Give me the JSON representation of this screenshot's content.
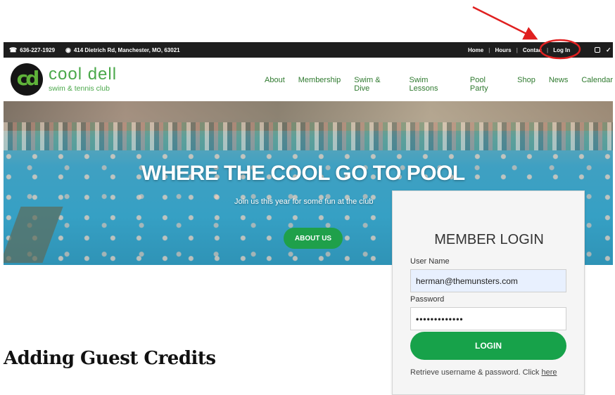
{
  "topbar": {
    "phone": "636-227-1929",
    "address": "414 Dietrich Rd, Manchester, MO, 63021",
    "nav": [
      "Home",
      "Hours",
      "Contac",
      "Log In"
    ]
  },
  "logo": {
    "mark": "cd",
    "title": "cool dell",
    "subtitle": "swim & tennis club"
  },
  "mainnav": [
    "About",
    "Membership",
    "Swim & Dive",
    "Swim Lessons",
    "Pool Party",
    "Shop",
    "News",
    "Calendar"
  ],
  "hero": {
    "title": "WHERE THE COOL GO TO POOL",
    "subtitle": "Join us this year for some fun at the club",
    "button": "ABOUT US"
  },
  "section_heading": "Adding Guest Credits",
  "login": {
    "title": "MEMBER LOGIN",
    "username_label": "User Name",
    "username_value": "herman@themunsters.com",
    "password_label": "Password",
    "password_value": "•••••••••••••",
    "button": "LOGIN",
    "retrieve_text": "Retrieve username & password. Click ",
    "retrieve_link": "here"
  },
  "colors": {
    "brand_green": "#4aa84a",
    "button_green": "#17a24a",
    "annotation_red": "#e02020",
    "topbar_bg": "#1e1e1e"
  },
  "icons": [
    "phone-icon",
    "map-pin-icon",
    "instagram-icon",
    "twitter-icon"
  ]
}
